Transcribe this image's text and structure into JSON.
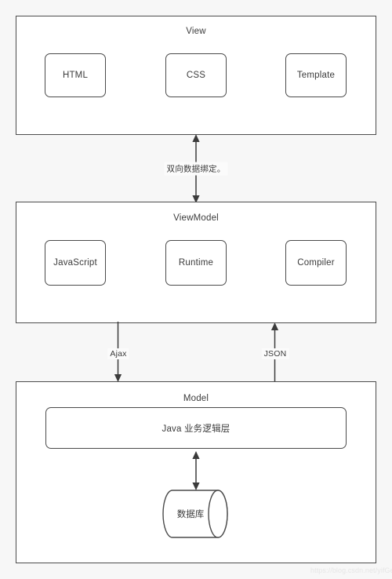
{
  "diagram": {
    "type": "mvvm-architecture-diagram",
    "background_color": "#f7f7f7",
    "stroke_color": "#4d4d4d",
    "text_color": "#3b3b3b",
    "layers": [
      {
        "id": "view",
        "title": "View",
        "nodes": [
          {
            "id": "html",
            "label": "HTML"
          },
          {
            "id": "css",
            "label": "CSS"
          },
          {
            "id": "template",
            "label": "Template"
          }
        ]
      },
      {
        "id": "viewmodel",
        "title": "ViewModel",
        "nodes": [
          {
            "id": "javascript",
            "label": "JavaScript"
          },
          {
            "id": "runtime",
            "label": "Runtime"
          },
          {
            "id": "compiler",
            "label": "Compiler"
          }
        ]
      },
      {
        "id": "model",
        "title": "Model",
        "nodes": [
          {
            "id": "java-business-logic",
            "label": "Java 业务逻辑层"
          }
        ],
        "database": {
          "id": "database",
          "label": "数据库"
        }
      }
    ],
    "edges": [
      {
        "id": "view-viewmodel",
        "label": "双向数据绑定。",
        "direction": "bidirectional"
      },
      {
        "id": "viewmodel-model-ajax",
        "label": "Ajax",
        "direction": "down"
      },
      {
        "id": "model-viewmodel-json",
        "label": "JSON",
        "direction": "up"
      },
      {
        "id": "logic-database",
        "label": "",
        "direction": "bidirectional"
      }
    ]
  },
  "watermark": {
    "text": "https://blog.csdn.net/yifGeek"
  }
}
